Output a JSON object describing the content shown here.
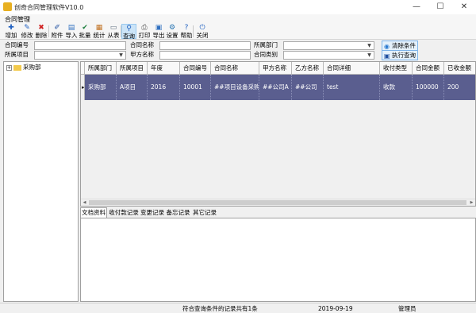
{
  "window": {
    "title": "创奇合同管理软件V10.0",
    "buttons": [
      "—",
      "☐",
      "✕"
    ]
  },
  "menu": {
    "label": "合同管理"
  },
  "toolbar": {
    "buttons": [
      {
        "label": "增加",
        "icon": "plus-icon",
        "glyph": "✚",
        "color": "#2060c0"
      },
      {
        "label": "修改",
        "icon": "edit-icon",
        "glyph": "✎",
        "color": "#2060c0"
      },
      {
        "label": "删除",
        "icon": "delete-icon",
        "glyph": "✖",
        "color": "#d02020"
      },
      {
        "label": "附件",
        "icon": "attachment-icon",
        "glyph": "✐",
        "color": "#2050a0"
      },
      {
        "label": "导入",
        "icon": "import-icon",
        "glyph": "▤",
        "color": "#3070c0"
      },
      {
        "label": "批量",
        "icon": "batch-icon",
        "glyph": "✔",
        "color": "#208040"
      },
      {
        "label": "统计",
        "icon": "stats-icon",
        "glyph": "▦",
        "color": "#c07020"
      },
      {
        "label": "从表",
        "icon": "subtable-icon",
        "glyph": "▭",
        "color": "#607080"
      },
      {
        "label": "查询",
        "icon": "search-icon",
        "glyph": "⚲",
        "color": "#2060c0"
      },
      {
        "label": "打印",
        "icon": "print-icon",
        "glyph": "⎙",
        "color": "#505050"
      },
      {
        "label": "导出",
        "icon": "export-icon",
        "glyph": "▣",
        "color": "#3070c0"
      },
      {
        "label": "设置",
        "icon": "settings-icon",
        "glyph": "⚙",
        "color": "#2070b0"
      },
      {
        "label": "帮助",
        "icon": "help-icon",
        "glyph": "?",
        "color": "#2060c0"
      },
      {
        "label": "关闭",
        "icon": "close-icon",
        "glyph": "⏻",
        "color": "#2060c0"
      }
    ]
  },
  "search": {
    "contract_no_label": "合同编号",
    "contract_no_value": "",
    "contract_name_label": "合同名称",
    "contract_name_value": "",
    "department_label": "所属部门",
    "department_value": "",
    "project_label": "所属项目",
    "project_value": "",
    "party_a_label": "甲方名称",
    "party_a_value": "",
    "contract_type_label": "合同类别",
    "contract_type_value": "",
    "clear_button": "清除条件",
    "query_button": "执行查询"
  },
  "tree": {
    "root": "采购部",
    "expander": "+"
  },
  "grid": {
    "columns": [
      "所属部门",
      "所属项目",
      "年度",
      "合同编号",
      "合同名称",
      "甲方名称",
      "乙方名称",
      "合同详细",
      "收付类型",
      "合同金额",
      "已收金额"
    ],
    "rows": [
      [
        "采购部",
        "A项目",
        "2016",
        "10001",
        "##项目设备采购",
        "##公司A",
        "##公司",
        "test",
        "收款",
        "100000",
        "200"
      ]
    ],
    "row_pointer": "▸"
  },
  "detail_tabs": [
    "文档资料",
    "收付款记录",
    "变更记录",
    "备忘记录",
    "其它记录"
  ],
  "status": {
    "record_count": "符合查询条件的记录共有1条",
    "date": "2019-09-19",
    "user": "管理员"
  }
}
